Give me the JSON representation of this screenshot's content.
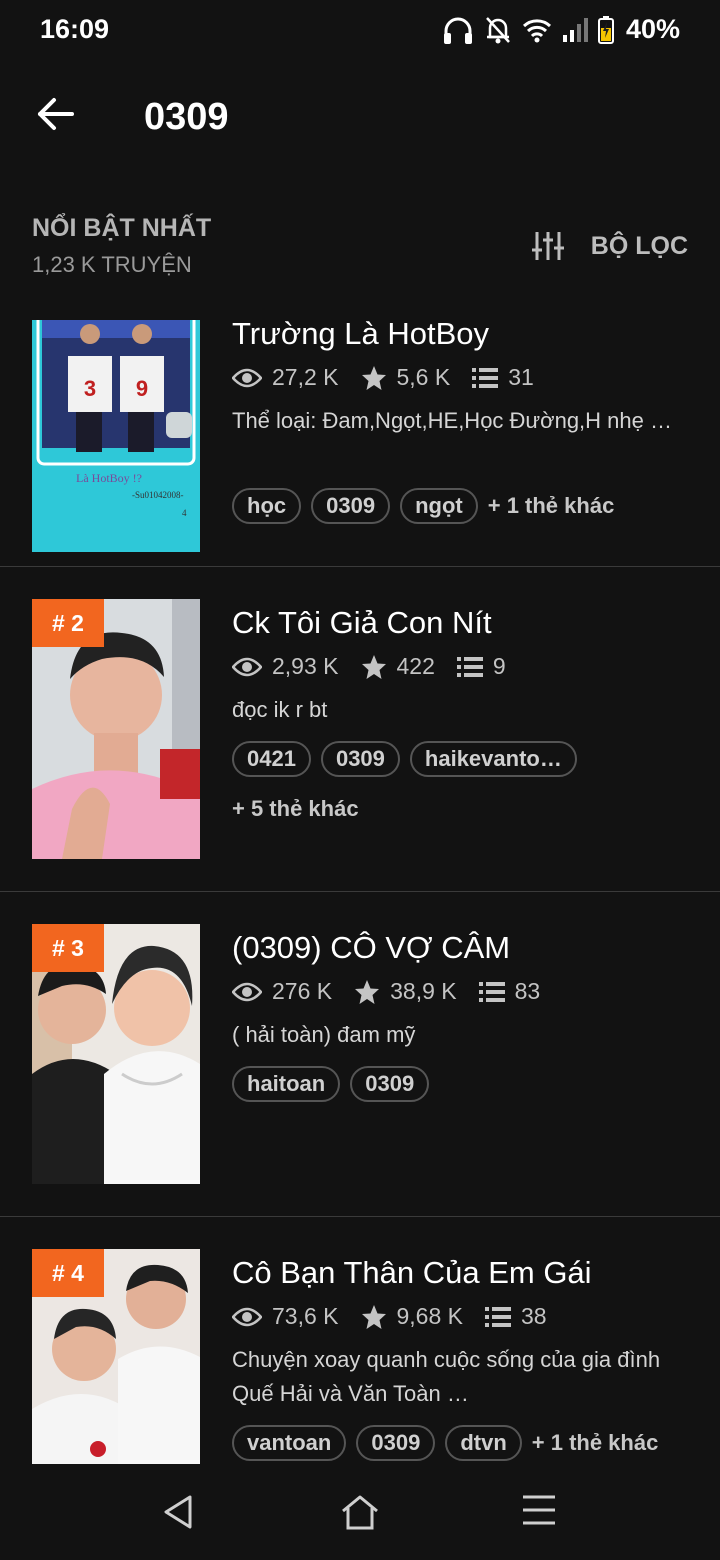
{
  "status": {
    "time": "16:09",
    "battery": "40%"
  },
  "header": {
    "title": "0309"
  },
  "sort": {
    "title": "NỔI BẬT NHẤT",
    "count": "1,23 K TRUYỆN",
    "filter_label": "BỘ LỌC"
  },
  "stories": [
    {
      "rank": "",
      "title": "Trường Là HotBoy",
      "views": "27,2 K",
      "votes": "5,6 K",
      "parts": "31",
      "desc": "Thể loại: Đam,Ngọt,HE,Học Đường,H nhẹ …",
      "tags": [
        "học",
        "0309",
        "ngọt"
      ],
      "more": "+ 1 thẻ khác",
      "cover_caption": "Là HotBoy !?",
      "cover_author": "-Su01042008-",
      "cover_jersey": [
        "3",
        "9"
      ]
    },
    {
      "rank": "# 2",
      "title": "Ck Tôi Giả Con Nít",
      "views": "2,93 K",
      "votes": "422",
      "parts": "9",
      "desc": "đọc ik r bt",
      "tags": [
        "0421",
        "0309",
        "haikevanto…"
      ],
      "more": "+ 5 thẻ khác"
    },
    {
      "rank": "# 3",
      "title": "(0309) CÔ VỢ CÂM",
      "views": "276 K",
      "votes": "38,9 K",
      "parts": "83",
      "desc": "( hải toàn) đam mỹ",
      "tags": [
        "haitoan",
        "0309"
      ],
      "more": ""
    },
    {
      "rank": "# 4",
      "title": "Cô Bạn Thân Của Em Gái",
      "views": "73,6 K",
      "votes": "9,68 K",
      "parts": "38",
      "desc": "Chuyện xoay quanh cuộc sống của gia đình Quế Hải và Văn Toàn …",
      "tags": [
        "vantoan",
        "0309",
        "dtvn"
      ],
      "more": "+ 1 thẻ khác"
    }
  ],
  "icons": {
    "back": "arrow-left-icon",
    "filter": "sliders-icon",
    "views": "eye-icon",
    "votes": "star-icon",
    "parts": "list-icon",
    "nav_back": "triangle-back-icon",
    "nav_home": "home-icon",
    "nav_menu": "menu-icon"
  },
  "colors": {
    "background": "#121212",
    "rank_badge": "#f2661f",
    "cover_teal": "#2ec8d8"
  }
}
